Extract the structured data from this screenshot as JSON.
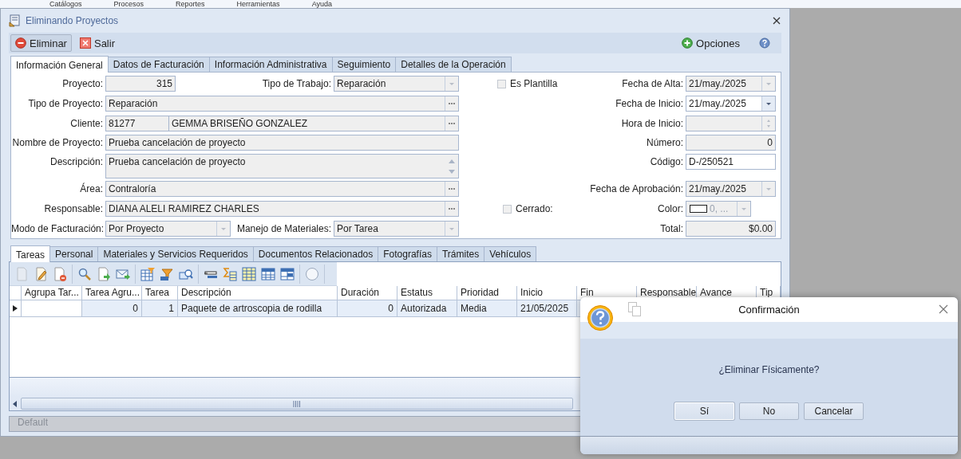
{
  "menu_bar": [
    "Catálogos",
    "Procesos",
    "Reportes",
    "Herramientas",
    "Ayuda"
  ],
  "window": {
    "title": "Eliminando Proyectos"
  },
  "toolbar": {
    "buttons": [
      {
        "label": "Eliminar",
        "kind": "delete",
        "hovered": true
      },
      {
        "label": "Salir",
        "kind": "exit",
        "hovered": false
      }
    ],
    "options": "Opciones"
  },
  "tabs": [
    {
      "label": "Información General",
      "selected": true
    },
    {
      "label": "Datos de Facturación",
      "selected": false
    },
    {
      "label": "Información Administrativa",
      "selected": false
    },
    {
      "label": "Seguimiento",
      "selected": false
    },
    {
      "label": "Detalles de la Operación",
      "selected": false
    }
  ],
  "form": {
    "left": [
      [
        {
          "label": "Proyecto:",
          "kind": "number",
          "value": "315",
          "disabled": true
        },
        {
          "label": "Tipo de Trabajo:",
          "kind": "combo",
          "value": "Reparación",
          "disabled": true
        }
      ],
      [
        {
          "label": "Tipo de Proyecto:",
          "kind": "lookup",
          "value": "Reparación",
          "disabled": true
        }
      ],
      [
        {
          "label": "Cliente:",
          "kind": "code_lookup",
          "code": "81277",
          "value": "GEMMA BRISEÑO GONZALEZ",
          "disabled": true
        }
      ],
      [
        {
          "label": "Nombre de Proyecto:",
          "kind": "text",
          "value": "Prueba cancelación de proyecto",
          "disabled": true
        }
      ],
      [
        {
          "label": "Descripción:",
          "kind": "memo",
          "value": "Prueba cancelación de proyecto",
          "disabled": true
        }
      ],
      [
        {
          "label": "Área:",
          "kind": "lookup",
          "value": "Contraloría",
          "disabled": true
        }
      ],
      [
        {
          "label": "Responsable:",
          "kind": "lookup",
          "value": "DIANA ALELI RAMIREZ CHARLES",
          "disabled": true
        }
      ],
      [
        {
          "label": "Modo de Facturación:",
          "kind": "combo",
          "value": "Por Proyecto",
          "disabled": true
        },
        {
          "label": "Manejo de Materiales:",
          "kind": "combo",
          "value": "Por Tarea",
          "disabled": true
        }
      ]
    ],
    "right": [
      {
        "checkbox": {
          "label": "Es Plantilla",
          "checked": false
        },
        "label": "Fecha de Alta:",
        "kind": "combo",
        "value": "21/may./2025",
        "disabled": true
      },
      {
        "label": "Fecha de Inicio:",
        "kind": "combo",
        "value": "21/may./2025",
        "disabled": false
      },
      {
        "label": "Hora de Inicio:",
        "kind": "spin",
        "disabled": true
      },
      {
        "label": "Número:",
        "kind": "number",
        "value": "0",
        "disabled": true
      },
      {
        "label": "Código:",
        "kind": "text",
        "value": "D-/250521",
        "disabled": false
      },
      {
        "label": "Fecha de Aprobación:",
        "kind": "combo",
        "value": "21/may./2025",
        "disabled": true
      },
      {
        "checkbox": {
          "label": "Cerrado:",
          "checked": false
        },
        "label": "Color:",
        "kind": "color",
        "value": "0, ...",
        "disabled": true
      },
      {
        "label": "Total:",
        "kind": "number",
        "value": "$0.00",
        "disabled": true
      }
    ]
  },
  "subtabs": [
    {
      "label": "Tareas",
      "selected": true
    },
    {
      "label": "Personal",
      "selected": false
    },
    {
      "label": "Materiales y Servicios Requeridos",
      "selected": false
    },
    {
      "label": "Documentos Relacionados",
      "selected": false
    },
    {
      "label": "Fotografías",
      "selected": false
    },
    {
      "label": "Trámites",
      "selected": false
    },
    {
      "label": "Vehículos",
      "selected": false
    }
  ],
  "grid_toolbar": [
    [
      {
        "disabled": true
      },
      {
        "disabled": false
      },
      {
        "disabled": false
      }
    ],
    [
      {
        "disabled": false
      },
      {
        "disabled": false
      },
      {
        "disabled": false
      }
    ],
    [
      {
        "disabled": false
      },
      {
        "disabled": false
      },
      {
        "disabled": false
      }
    ],
    [
      {
        "disabled": false
      },
      {
        "disabled": false
      },
      {
        "disabled": false
      },
      {
        "disabled": false
      },
      {
        "disabled": false
      }
    ],
    [
      {
        "disabled": false
      }
    ]
  ],
  "table": {
    "columns": [
      "Agrupa Tar...",
      "Tarea Agru...",
      "Tarea",
      "Descripción",
      "Duración",
      "Estatus",
      "Prioridad",
      "Inicio",
      "Fin",
      "Responsable",
      "Avance",
      "Tip"
    ],
    "rows": [
      {
        "selected": true,
        "cells": [
          "",
          "0",
          "1",
          "Paquete de artroscopia de rodilla",
          "0",
          "Autorizada",
          "Media",
          "21/05/2025"
        ]
      }
    ]
  },
  "status_bar": "Default",
  "dialog": {
    "title": "Confirmación",
    "message": "¿Eliminar Físicamente?",
    "buttons": [
      {
        "label": "Sí",
        "default": true
      },
      {
        "label": "No",
        "default": false
      },
      {
        "label": "Cancelar",
        "default": false
      }
    ]
  }
}
